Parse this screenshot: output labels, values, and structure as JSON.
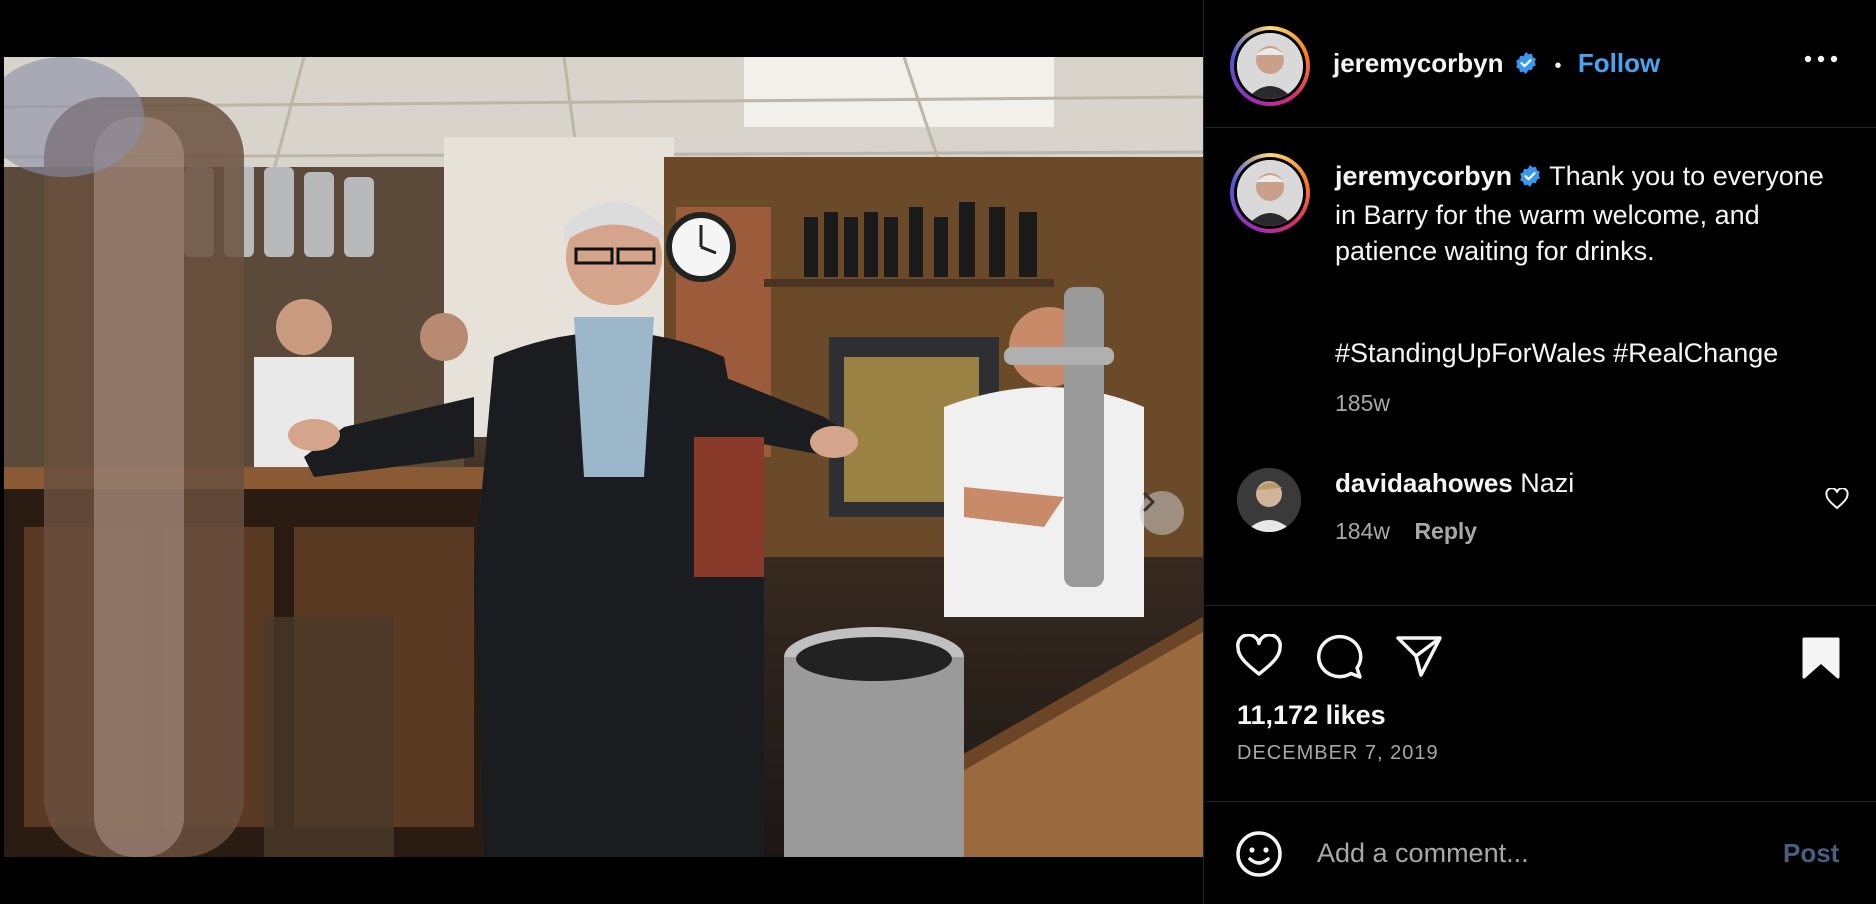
{
  "post": {
    "username": "jeremycorbyn",
    "follow_label": "Follow",
    "separator": "•",
    "caption": {
      "username": "jeremycorbyn",
      "text": "Thank you to everyone in Barry for the warm welcome, and patience waiting for drinks.",
      "hashtags": "#StandingUpForWales #RealChange",
      "age": "185w"
    },
    "comments": [
      {
        "username": "davidaahowes",
        "text": "Nazi",
        "age": "184w",
        "reply_label": "Reply"
      }
    ],
    "likes": "11,172 likes",
    "date": "DECEMBER 7, 2019",
    "add_comment": {
      "placeholder": "Add a comment...",
      "post_label": "Post"
    },
    "carousel": {
      "count": 3,
      "active": 1
    }
  },
  "icons": {
    "verified": "verified-badge-icon",
    "more": "more-options-icon",
    "like": "heart-icon",
    "comment": "comment-bubble-icon",
    "share": "paper-plane-icon",
    "save": "bookmark-icon",
    "emoji": "emoji-icon",
    "next": "chevron-right-icon"
  },
  "colors": {
    "accent": "#4aa3f0",
    "verified": "#3897f0",
    "muted": "#a8a8a8",
    "post_disabled": "#4a5f80"
  }
}
